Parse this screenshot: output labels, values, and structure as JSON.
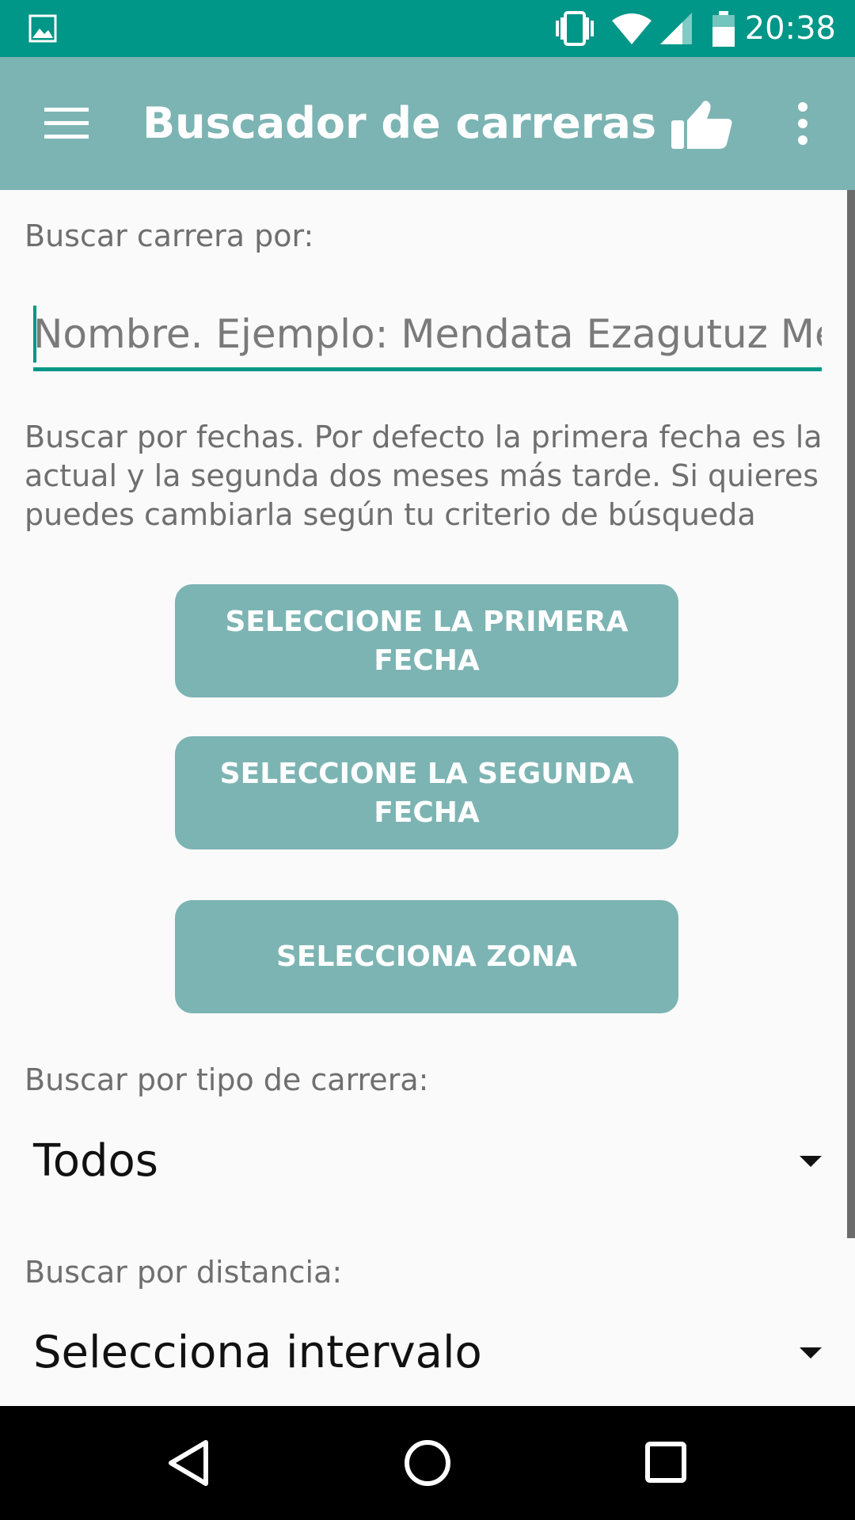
{
  "status_bar": {
    "time": "20:38"
  },
  "app_bar": {
    "title": "Buscador de carreras",
    "icons": [
      "menu-icon",
      "thumbs-up-icon",
      "more-vert-icon"
    ]
  },
  "search": {
    "by_label": "Buscar carrera por:",
    "name_placeholder": "Nombre. Ejemplo: Mendata Ezagutuz Men",
    "name_value": ""
  },
  "dates": {
    "description": "Buscar por fechas. Por defecto la primera fecha es la actual y la segunda dos meses más tarde. Si quieres puedes cambiarla según tu criterio de búsqueda",
    "first_button": "SELECCIONE LA PRIMERA FECHA",
    "second_button": "SELECCIONE LA SEGUNDA FECHA"
  },
  "zone": {
    "button": "SELECCIONA ZONA"
  },
  "race_type": {
    "label": "Buscar por tipo de carrera:",
    "selected": "Todos"
  },
  "distance": {
    "label": "Buscar por distancia:",
    "selected": "Selecciona intervalo"
  },
  "colors": {
    "status_bar": "#009688",
    "app_bar": "#7cb4b3",
    "button": "#7cb4b3",
    "accent": "#009688"
  }
}
